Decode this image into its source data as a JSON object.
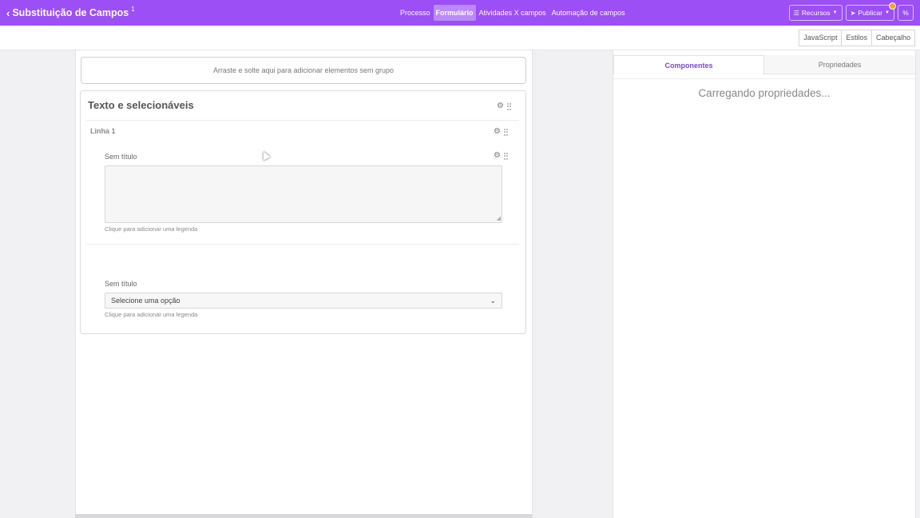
{
  "header": {
    "title": "Substituição de Campos",
    "version": "1",
    "nav": [
      {
        "label": "Processo"
      },
      {
        "label": "Formulário"
      },
      {
        "label": "Atividades X campos"
      },
      {
        "label": "Automação de campos"
      }
    ],
    "recursos_label": "Recursos",
    "publicar_label": "Publicar"
  },
  "subbar": {
    "tabs": [
      "JavaScript",
      "Estilos",
      "Cabeçalho"
    ]
  },
  "canvas": {
    "dropzone_text": "Arraste e solte aqui para adicionar elementos sem grupo",
    "group_title": "Texto e selecionáveis",
    "row_label": "Linha 1",
    "field1": {
      "label": "Sem título",
      "legend": "Clique para adicionar uma legenda"
    },
    "field2": {
      "label": "Sem título",
      "selected": "Selecione uma opção",
      "legend": "Clique para adicionar uma legenda"
    }
  },
  "panel": {
    "tabs": [
      "Componentes",
      "Propriedades"
    ],
    "loading_text": "Carregando propriedades..."
  },
  "colors": {
    "brand": "#9b4ff5",
    "accent": "#7a46d6",
    "badge": "#f5a623"
  }
}
